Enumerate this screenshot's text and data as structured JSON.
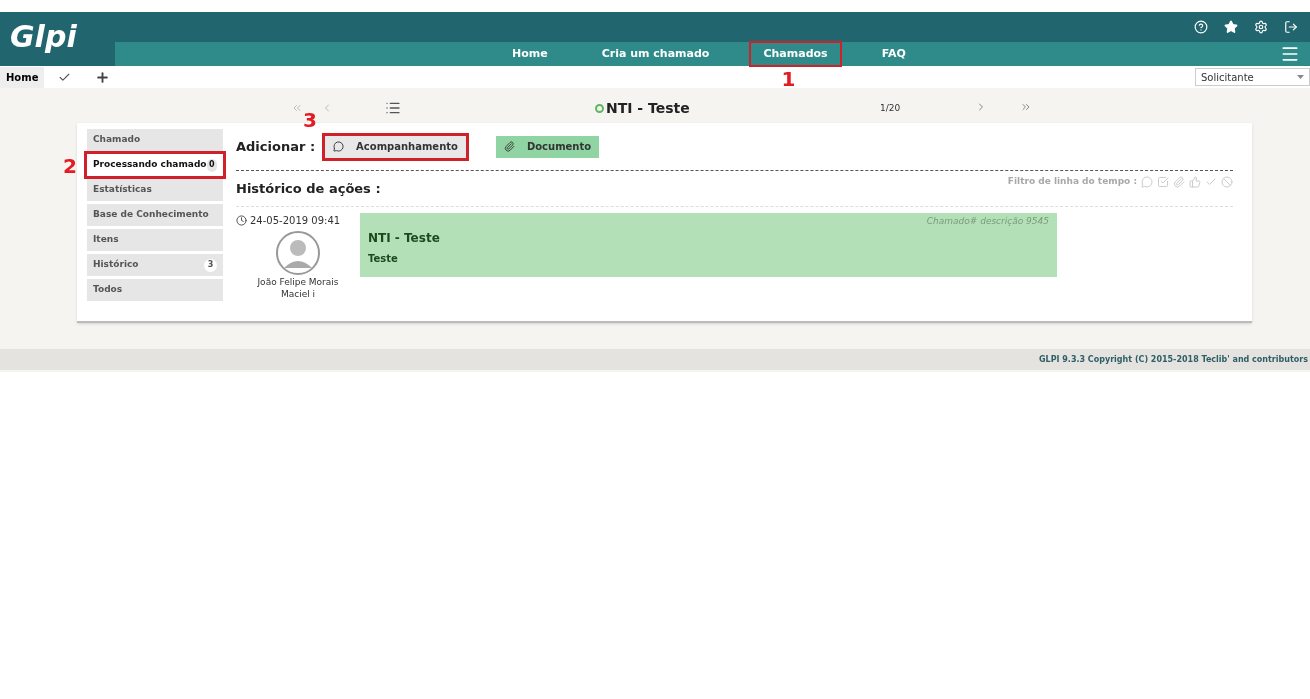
{
  "logo": "Glpi",
  "nav": [
    {
      "label": "Home"
    },
    {
      "label": "Cria um chamado"
    },
    {
      "label": "Chamados",
      "callout": "1"
    },
    {
      "label": "FAQ"
    }
  ],
  "breadcrumb": "Home",
  "profile_select": {
    "value": "Solicitante"
  },
  "pager": {
    "title": "NTI - Teste",
    "position": "1/20"
  },
  "sidebar": [
    {
      "label": "Chamado",
      "selected": false
    },
    {
      "label": "Processando chamado",
      "selected": true,
      "badge": "0",
      "callout": "2"
    },
    {
      "label": "Estatísticas",
      "selected": false
    },
    {
      "label": "Base de Conhecimento",
      "selected": false
    },
    {
      "label": "Itens",
      "selected": false
    },
    {
      "label": "Histórico",
      "selected": false,
      "badge": "3"
    },
    {
      "label": "Todos",
      "selected": false
    }
  ],
  "add_label": "Adicionar :",
  "add_buttons": [
    {
      "label": "Acompanhamento",
      "kind": "followup",
      "callout": "3"
    },
    {
      "label": "Documento",
      "kind": "document"
    }
  ],
  "history_title": "Histórico de ações :",
  "filter_label": "Filtro de linha do tempo :",
  "entry": {
    "date": "24-05-2019 09:41",
    "author": "João Felipe Morais Maciel",
    "info": "i",
    "meta": "Chamado# descrição 9545",
    "title": "NTI - Teste",
    "body": "Teste"
  },
  "footer": "GLPI 9.3.3 Copyright (C) 2015-2018 Teclib' and contributors"
}
